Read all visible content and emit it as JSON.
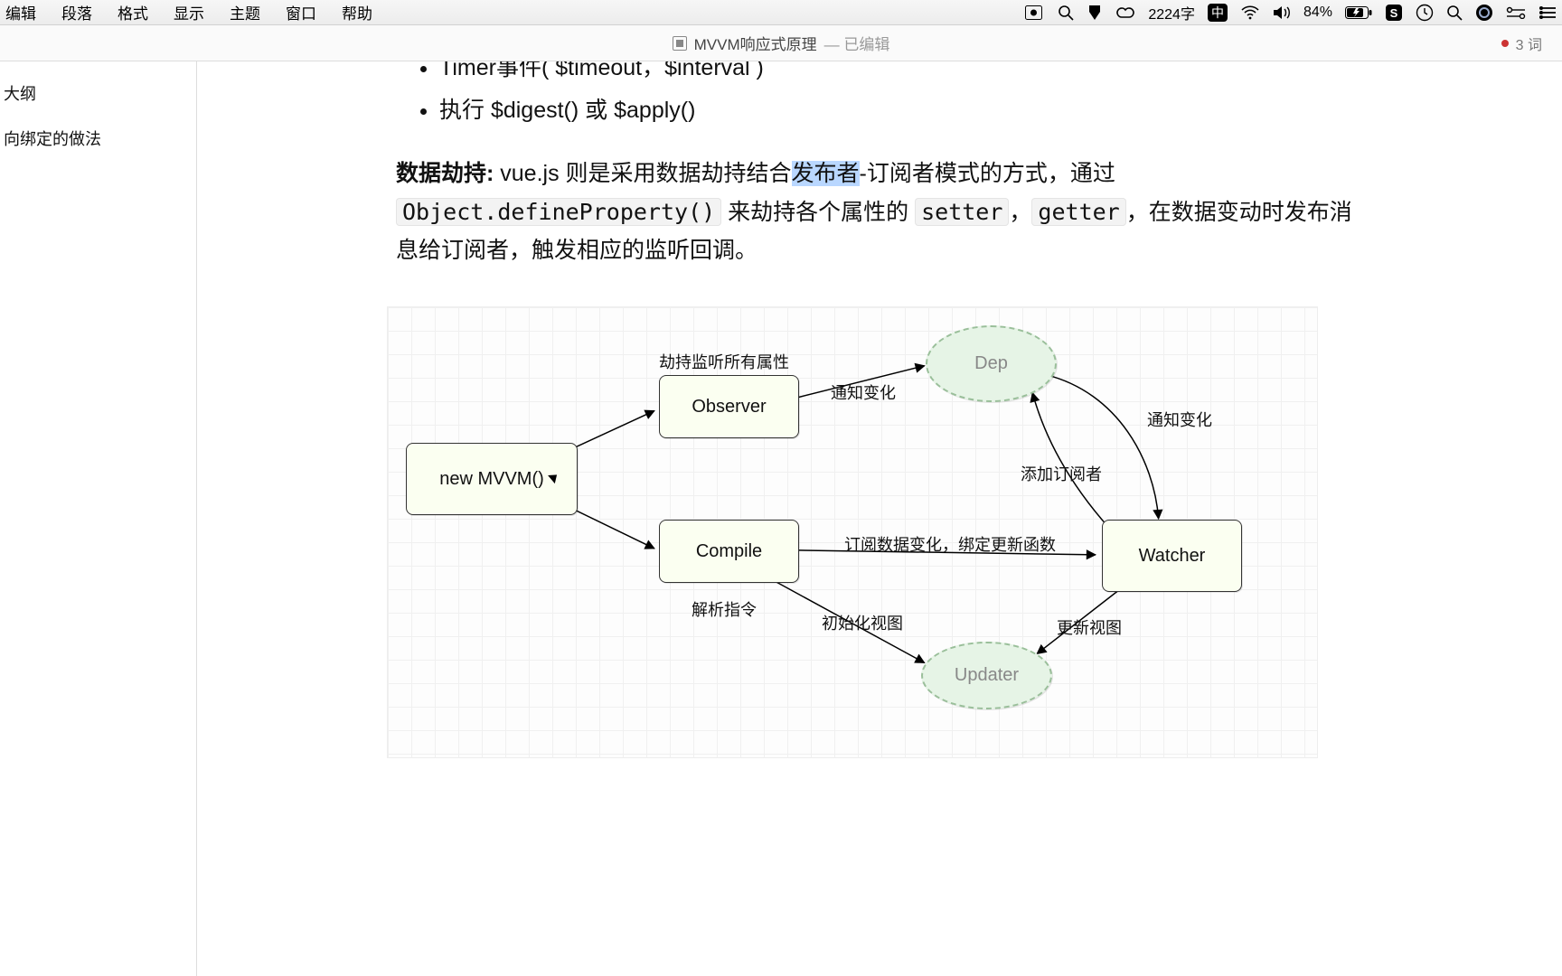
{
  "menubar": {
    "items": [
      "编辑",
      "段落",
      "格式",
      "显示",
      "主题",
      "窗口",
      "帮助"
    ],
    "char_count": "2224字",
    "ime": "中",
    "battery": "84%"
  },
  "tabbar": {
    "doc_title": "MVVM响应式原理",
    "edited_suffix": "— 已编辑",
    "word_count": "3 词"
  },
  "sidebar": {
    "title": "大纲",
    "items": [
      "向绑定的做法"
    ]
  },
  "content": {
    "bullets": [
      "Timer事件( $timeout，$interval )",
      "执行 $digest() 或 $apply()"
    ],
    "p_bold": "数据劫持:",
    "p_seg1": " vue.js 则是采用数据劫持结合",
    "p_hl": "发布者",
    "p_seg2": "-订阅者模式的方式，通过",
    "p_code1": "Object.defineProperty()",
    "p_seg3": " 来劫持各个属性的 ",
    "p_code2": "setter",
    "p_seg4": "，",
    "p_code3": "getter",
    "p_seg5": "，在数据变动时发布消息给订阅者，触发相应的监听回调。"
  },
  "diagram": {
    "nodes": {
      "mvvm": "new MVVM()",
      "observer": "Observer",
      "compile": "Compile",
      "dep": "Dep",
      "watcher": "Watcher",
      "updater": "Updater"
    },
    "labels": {
      "l_obs_top": "劫持监听所有属性",
      "l_obs_dep": "通知变化",
      "l_dep_watch": "通知变化",
      "l_watch_dep": "添加订阅者",
      "l_compile_watch": "订阅数据变化，绑定更新函数",
      "l_compile_bot": "解析指令",
      "l_compile_upd": "初始化视图",
      "l_watch_upd": "更新视图"
    }
  }
}
